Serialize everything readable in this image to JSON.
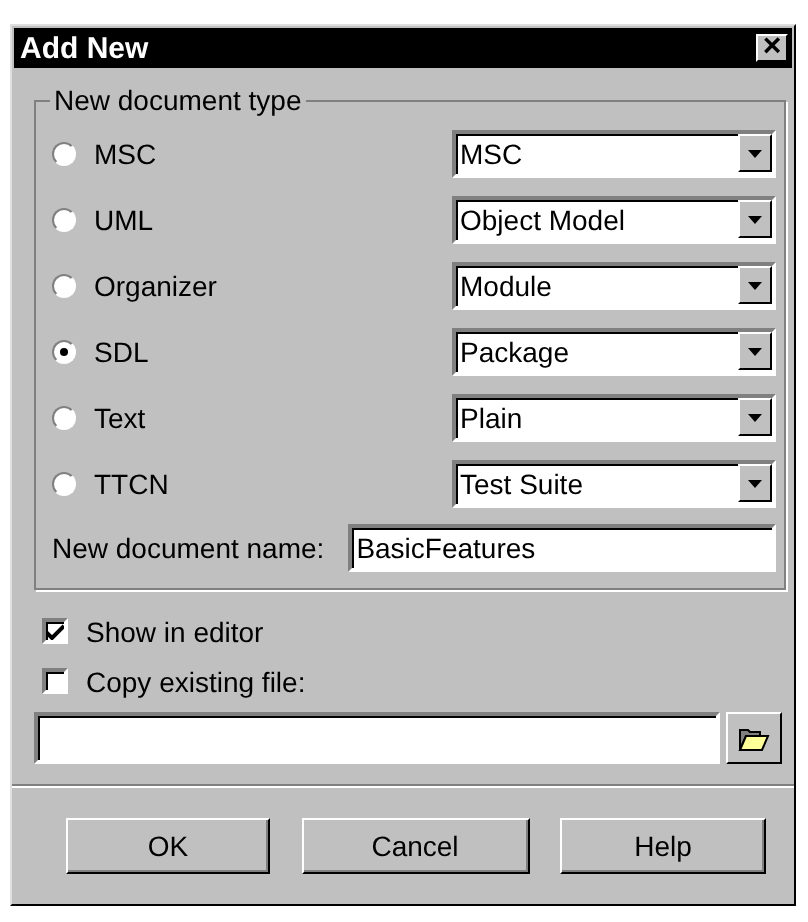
{
  "window": {
    "title": "Add New",
    "close": "×"
  },
  "group": {
    "title": "New document type",
    "types": [
      {
        "label": "MSC",
        "selected": false,
        "option": "MSC"
      },
      {
        "label": "UML",
        "selected": false,
        "option": "Object Model"
      },
      {
        "label": "Organizer",
        "selected": false,
        "option": "Module"
      },
      {
        "label": "SDL",
        "selected": true,
        "option": "Package"
      },
      {
        "label": "Text",
        "selected": false,
        "option": "Plain"
      },
      {
        "label": "TTCN",
        "selected": false,
        "option": "Test Suite"
      }
    ],
    "name_label": "New document name:",
    "name_value": "BasicFeatures"
  },
  "checkboxes": [
    {
      "label": "Show in editor",
      "checked": true
    },
    {
      "label": "Copy existing file:",
      "checked": false
    }
  ],
  "buttons": [
    "OK",
    "Cancel",
    "Help"
  ]
}
